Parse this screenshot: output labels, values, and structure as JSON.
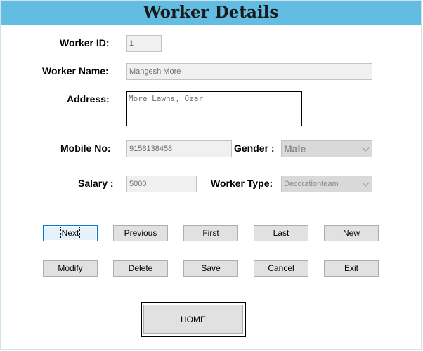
{
  "header": {
    "title": "Worker Details"
  },
  "form": {
    "worker_id_label": "Worker ID:",
    "worker_id_value": "1",
    "worker_name_label": "Worker Name:",
    "worker_name_value": "Mangesh More",
    "address_label": "Address:",
    "address_value": "More Lawns, Ozar",
    "mobile_label": "Mobile No:",
    "mobile_value": "9158138458",
    "gender_label": "Gender :",
    "gender_value": "Male",
    "salary_label": "Salary :",
    "salary_value": "5000",
    "worker_type_label": "Worker Type:",
    "worker_type_value": "Decorationteam"
  },
  "buttons": {
    "next": "Next",
    "previous": "Previous",
    "first": "First",
    "last": "Last",
    "new": "New",
    "modify": "Modify",
    "delete": "Delete",
    "save": "Save",
    "cancel": "Cancel",
    "exit": "Exit",
    "home": "HOME"
  },
  "icons": {
    "combo_arrow": "chevron-down-icon"
  },
  "colors": {
    "title_bar": "#63bde2",
    "focus_border": "#0078d7"
  }
}
